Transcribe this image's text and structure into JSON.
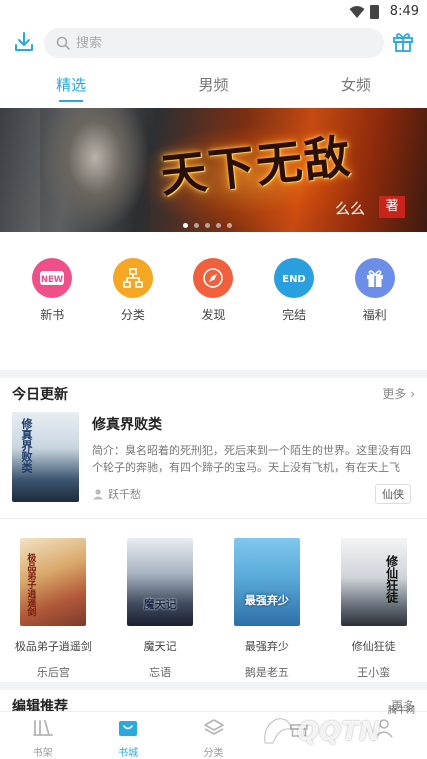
{
  "status_bar": {
    "time": "8:49"
  },
  "search": {
    "placeholder": "搜索"
  },
  "tabs": [
    {
      "label": "精选"
    },
    {
      "label": "男频"
    },
    {
      "label": "女频"
    }
  ],
  "banner": {
    "title": "天下无敌",
    "author": "么么",
    "seal": "著"
  },
  "categories": [
    {
      "label": "新书",
      "badge": "NEW",
      "color": "#f0508a"
    },
    {
      "label": "分类",
      "color": "#f5a623"
    },
    {
      "label": "发现",
      "color": "#f0603c"
    },
    {
      "label": "完结",
      "badge": "END",
      "color": "#2a9fde"
    },
    {
      "label": "福利",
      "color": "#6d8ee8"
    }
  ],
  "today": {
    "title": "今日更新",
    "more": "更多",
    "feature": {
      "title": "修真界败类",
      "cover_text": "修真界败类",
      "desc": "简介：臭名昭着的死刑犯，死后来到一个陌生的世界。这里没有四个轮子的奔驰，有四个蹄子的宝马。天上没有飞机，有在天上飞的...",
      "author": "跃千愁",
      "tag": "仙侠"
    },
    "books": [
      {
        "title": "极品弟子逍遥剑",
        "author": "乐后宫",
        "cover_text": "极品弟子逍遥剑"
      },
      {
        "title": "魔天记",
        "author": "忘语",
        "cover_text": "魔天记"
      },
      {
        "title": "最强弃少",
        "author": "鹅是老五",
        "cover_text": "最强弃少"
      },
      {
        "title": "修仙狂徒",
        "author": "王小蛮",
        "cover_text": "修仙狂徒"
      }
    ]
  },
  "editor": {
    "title": "编辑推荐",
    "more": "更多"
  },
  "bottom_nav": [
    {
      "label": "书架"
    },
    {
      "label": "书城"
    },
    {
      "label": "分类"
    },
    {
      "label": ""
    },
    {
      "label": ""
    }
  ],
  "watermark": {
    "text": "QQTN",
    "small": "腾牛网"
  },
  "colors": {
    "accent": "#2aa8e0"
  }
}
